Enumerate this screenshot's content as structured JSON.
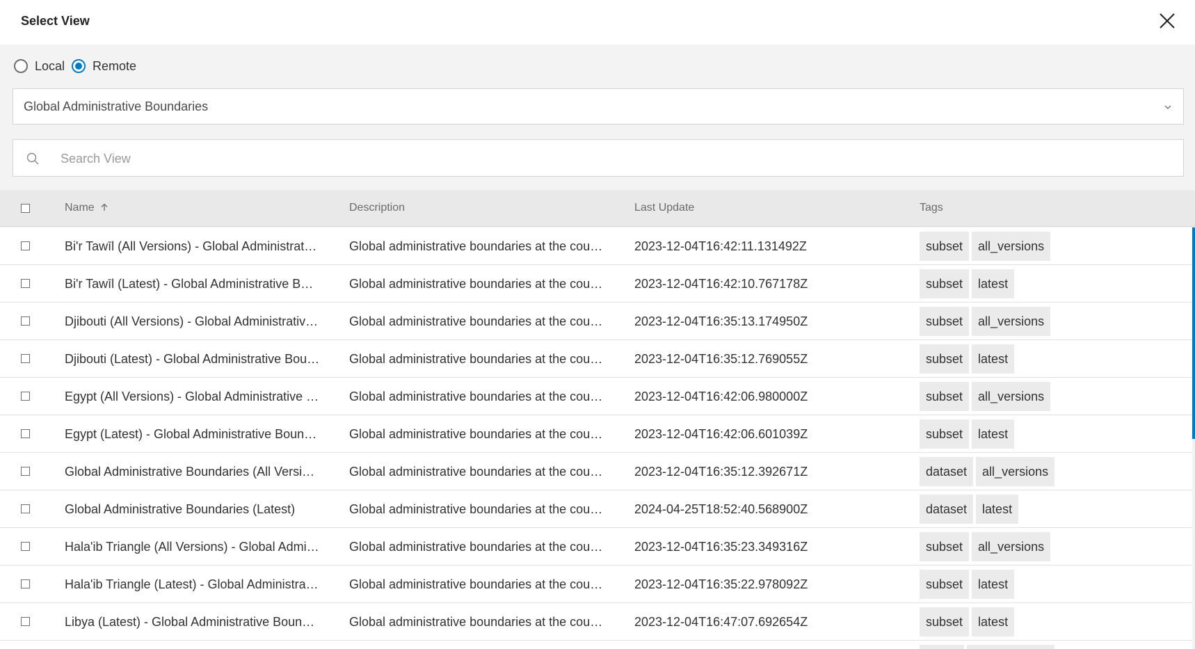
{
  "dialog": {
    "title": "Select View",
    "close_icon": "close-icon"
  },
  "source": {
    "options": [
      {
        "label": "Local",
        "selected": false
      },
      {
        "label": "Remote",
        "selected": true
      }
    ]
  },
  "dataset_select": {
    "value": "Global Administrative Boundaries",
    "icon": "chevron-down-icon"
  },
  "search": {
    "placeholder": "Search View",
    "value": "",
    "icon": "search-icon"
  },
  "table": {
    "columns": {
      "name": "Name",
      "description": "Description",
      "last_update": "Last Update",
      "tags": "Tags"
    },
    "sort": {
      "column": "Name",
      "direction": "ascending",
      "icon": "arrow-up-icon"
    },
    "rows": [
      {
        "name": "Bi'r Tawīl (All Versions) - Global Administrat…",
        "description": "Global administrative boundaries at the cou…",
        "last_update": "2023-12-04T16:42:11.131492Z",
        "tags": [
          "subset",
          "all_versions"
        ]
      },
      {
        "name": "Bi'r Tawīl (Latest) - Global Administrative B…",
        "description": "Global administrative boundaries at the cou…",
        "last_update": "2023-12-04T16:42:10.767178Z",
        "tags": [
          "subset",
          "latest"
        ]
      },
      {
        "name": "Djibouti (All Versions) - Global Administrativ…",
        "description": "Global administrative boundaries at the cou…",
        "last_update": "2023-12-04T16:35:13.174950Z",
        "tags": [
          "subset",
          "all_versions"
        ]
      },
      {
        "name": "Djibouti (Latest) - Global Administrative Bou…",
        "description": "Global administrative boundaries at the cou…",
        "last_update": "2023-12-04T16:35:12.769055Z",
        "tags": [
          "subset",
          "latest"
        ]
      },
      {
        "name": "Egypt (All Versions) - Global Administrative …",
        "description": "Global administrative boundaries at the cou…",
        "last_update": "2023-12-04T16:42:06.980000Z",
        "tags": [
          "subset",
          "all_versions"
        ]
      },
      {
        "name": "Egypt (Latest) - Global Administrative Boun…",
        "description": "Global administrative boundaries at the cou…",
        "last_update": "2023-12-04T16:42:06.601039Z",
        "tags": [
          "subset",
          "latest"
        ]
      },
      {
        "name": "Global Administrative Boundaries (All Versi…",
        "description": "Global administrative boundaries at the cou…",
        "last_update": "2023-12-04T16:35:12.392671Z",
        "tags": [
          "dataset",
          "all_versions"
        ]
      },
      {
        "name": "Global Administrative Boundaries (Latest)",
        "description": "Global administrative boundaries at the cou…",
        "last_update": "2024-04-25T18:52:40.568900Z",
        "tags": [
          "dataset",
          "latest"
        ]
      },
      {
        "name": "Hala'ib Triangle (All Versions) - Global Admi…",
        "description": "Global administrative boundaries at the cou…",
        "last_update": "2023-12-04T16:35:23.349316Z",
        "tags": [
          "subset",
          "all_versions"
        ]
      },
      {
        "name": "Hala'ib Triangle (Latest) - Global Administra…",
        "description": "Global administrative boundaries at the cou…",
        "last_update": "2023-12-04T16:35:22.978092Z",
        "tags": [
          "subset",
          "latest"
        ]
      },
      {
        "name": "Libya (Latest) - Global Administrative Boun…",
        "description": "Global administrative boundaries at the cou…",
        "last_update": "2023-12-04T16:47:07.692654Z",
        "tags": [
          "subset",
          "latest"
        ]
      },
      {
        "name": "",
        "description": "",
        "last_update": "",
        "tags": [
          "",
          ""
        ]
      }
    ]
  },
  "colors": {
    "accent": "#007ac2",
    "header_bg": "#e9e9e9",
    "tag_bg": "#ebebeb"
  }
}
